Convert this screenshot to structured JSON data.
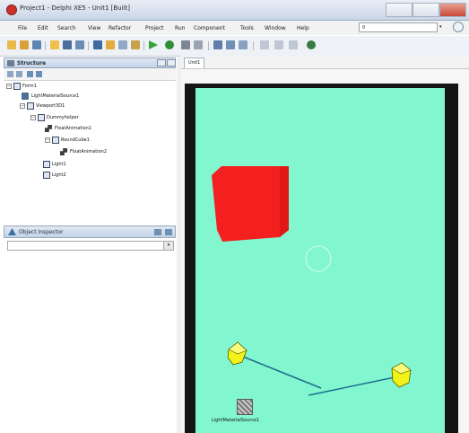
{
  "window": {
    "title": "Project1 - Delphi XE5 - Unit1 [Built]"
  },
  "menu": {
    "items": [
      "File",
      "Edit",
      "Search",
      "View",
      "Refactor",
      "Project",
      "Run",
      "Component",
      "Tools",
      "Window",
      "Help"
    ],
    "search_value": "0"
  },
  "structure": {
    "title": "Structure",
    "tree": [
      {
        "label": "Form1",
        "icon": "form-icon"
      },
      {
        "label": "LightMaterialSource1",
        "icon": "component-icon"
      },
      {
        "label": "Viewport3D1",
        "icon": "form-icon"
      },
      {
        "label": "Dummyhelper",
        "icon": "form-icon"
      },
      {
        "label": "FloatAnimation1",
        "icon": "animation-icon"
      },
      {
        "label": "RoundCube1",
        "icon": "form-icon"
      },
      {
        "label": "FloatAnimation2",
        "icon": "animation-icon"
      },
      {
        "label": "Light1",
        "icon": "form-icon"
      },
      {
        "label": "Light2",
        "icon": "form-icon"
      }
    ]
  },
  "inspector": {
    "title": "Object Inspector"
  },
  "designer": {
    "tab_label": "Unit1",
    "light_material_label": "LightMaterialSource1",
    "colors": {
      "canvas": "#82f7cf",
      "cube": "#f41f1f",
      "light": "#f2f218",
      "frame": "#151515"
    }
  }
}
